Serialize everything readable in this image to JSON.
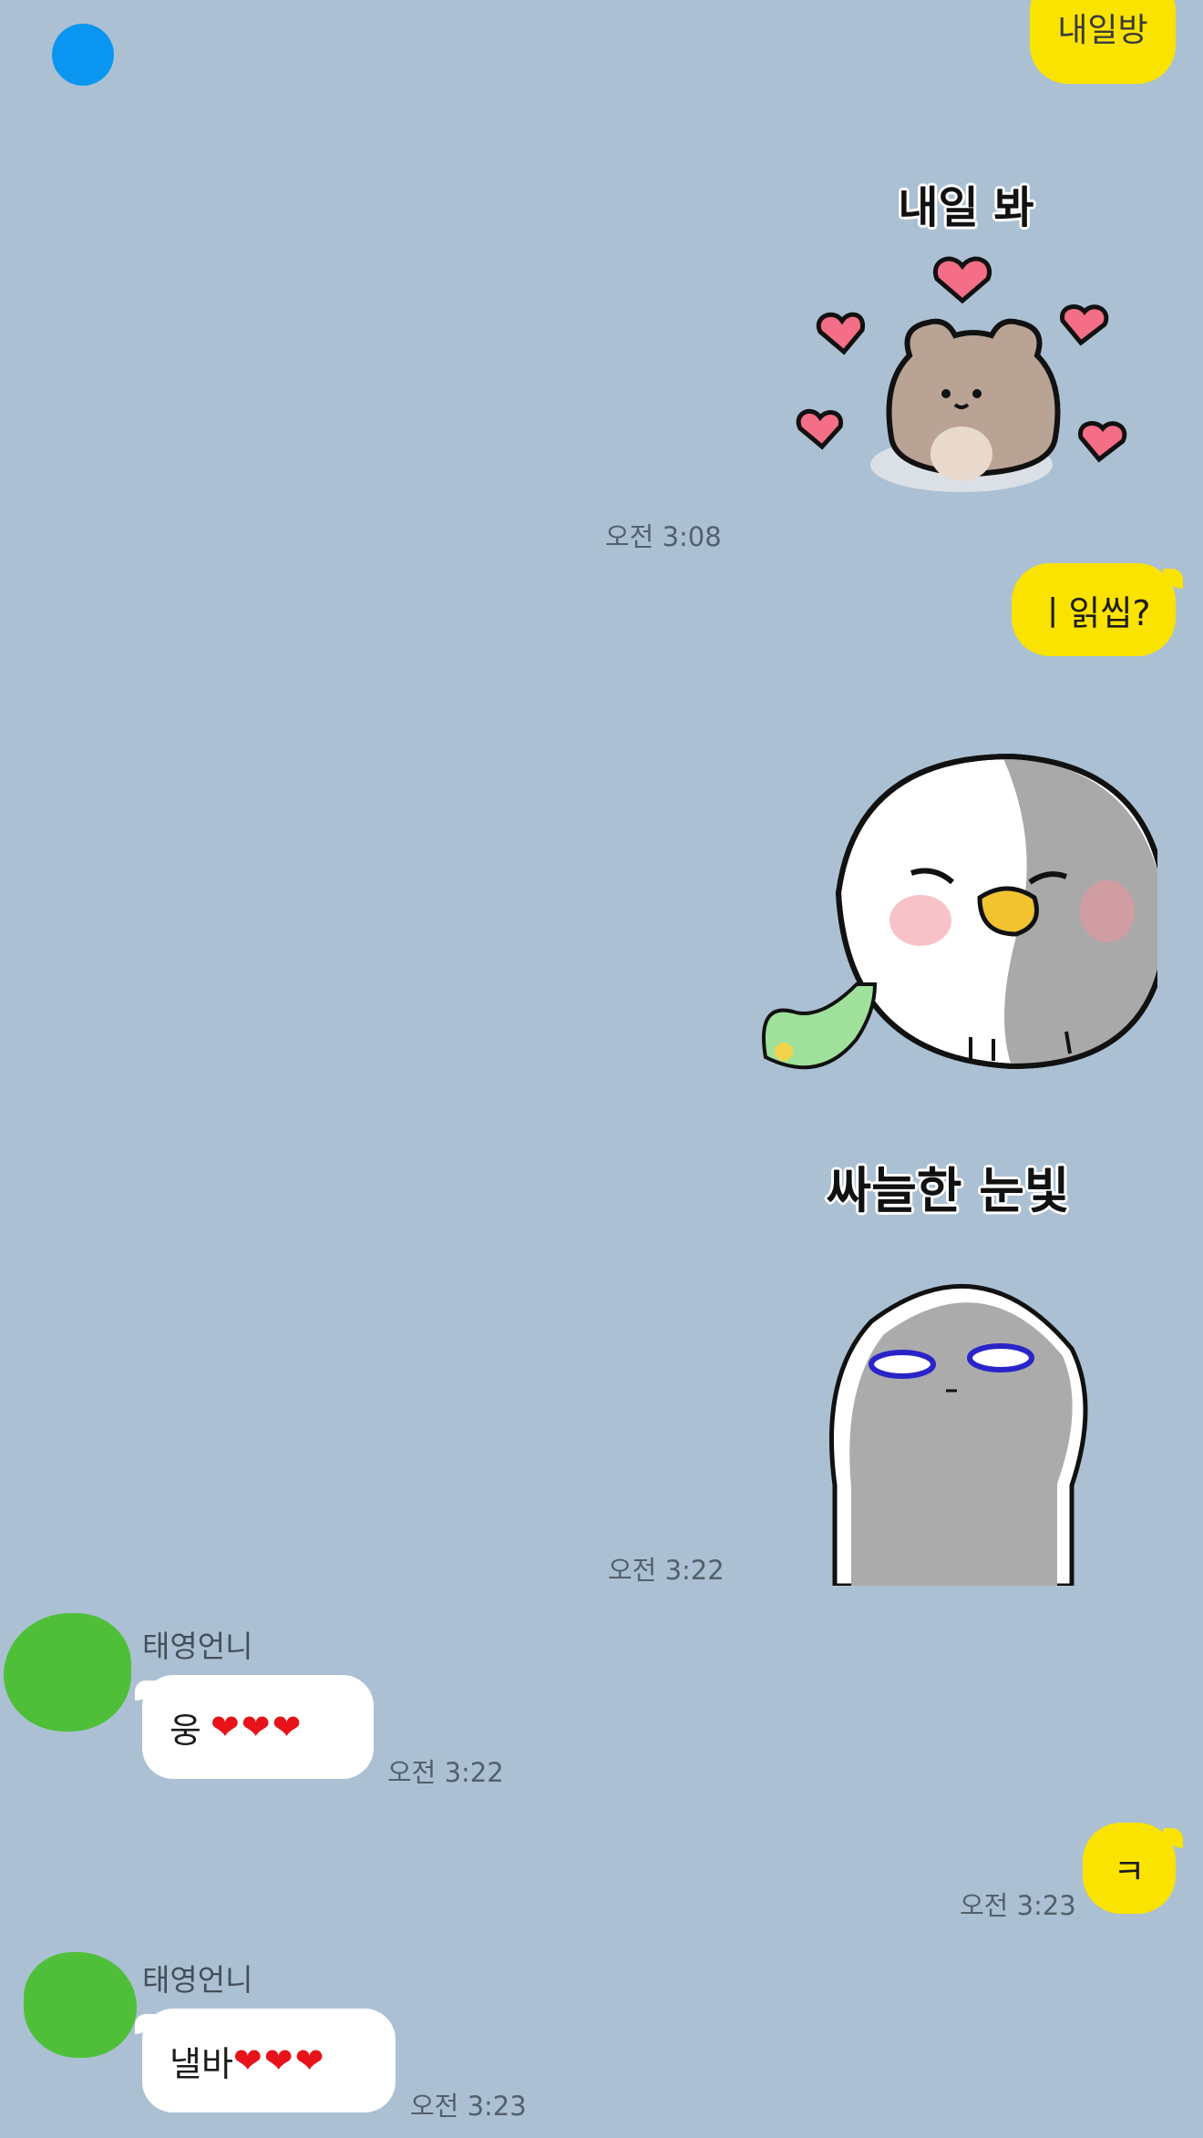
{
  "top": {
    "partial_bubble_text": "내일방"
  },
  "messages": {
    "sticker_bear": {
      "caption": "내일 봐",
      "time": "오전 3:08"
    },
    "msg_question": {
      "text": "ㅣ읽씹?"
    },
    "sticker_duck": {},
    "sticker_gray": {
      "caption": "싸늘한 눈빛",
      "time": "오전 3:22"
    },
    "reply1": {
      "sender": "태영언니",
      "text": "웅",
      "hearts": "❤❤❤",
      "time": "오전 3:22"
    },
    "msg_k": {
      "text": "ㅋ",
      "time": "오전 3:23"
    },
    "reply2": {
      "sender": "태영언니",
      "text": "낼바",
      "hearts": "❤❤❤",
      "time": "오전 3:23"
    }
  },
  "colors": {
    "background": "#abc0d3",
    "my_bubble": "#fae300",
    "other_bubble": "#ffffff",
    "avatar_cover": "#4fbf3a",
    "top_dot": "#0a96f0"
  }
}
